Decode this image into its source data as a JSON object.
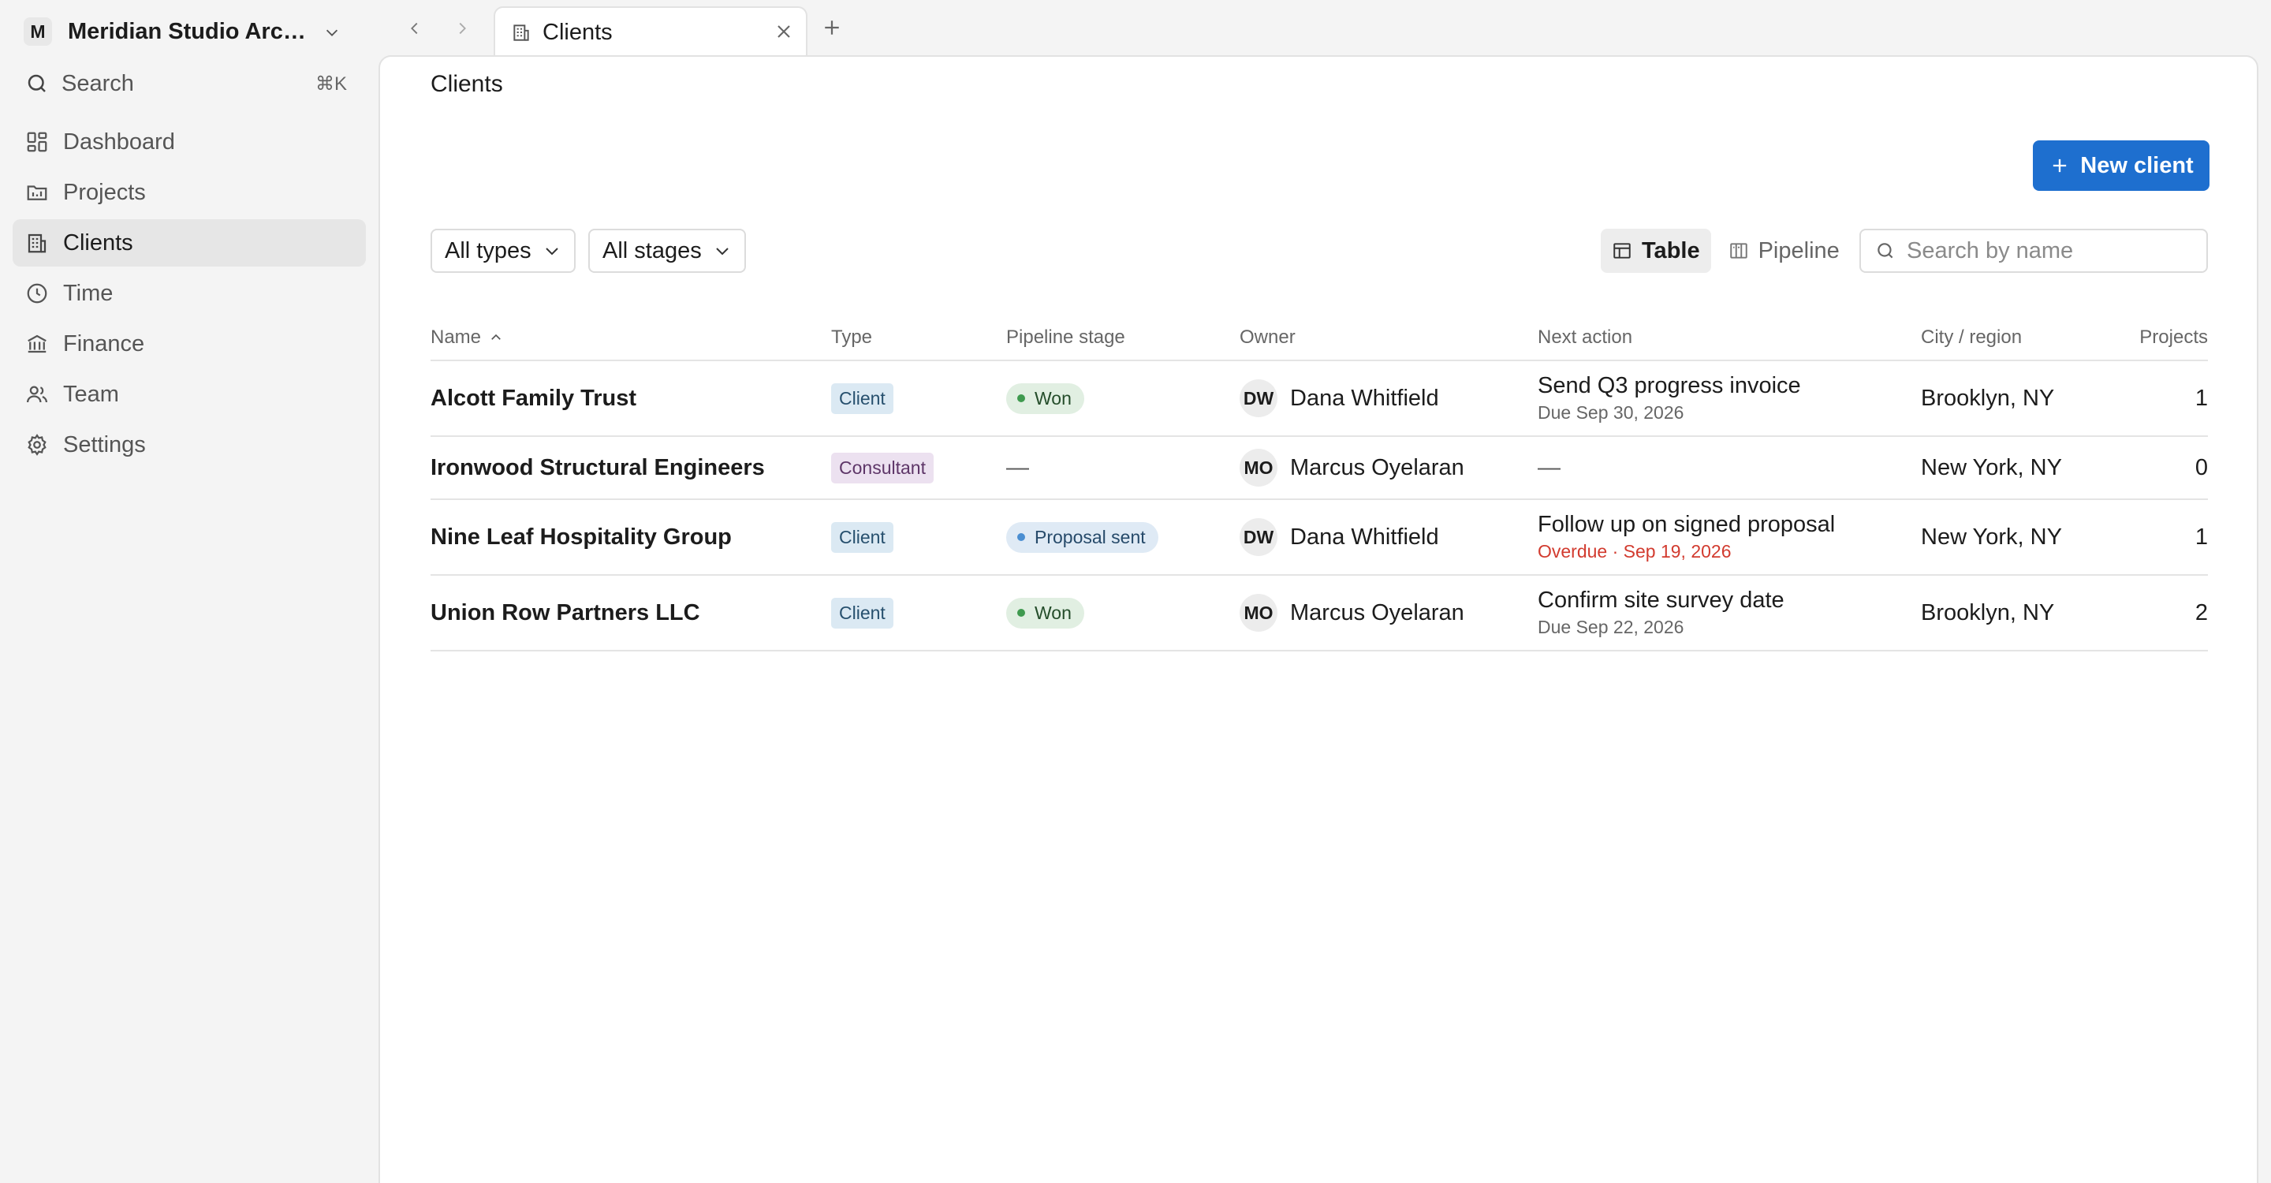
{
  "workspace": {
    "initial": "M",
    "name": "Meridian Studio Architects"
  },
  "search": {
    "label": "Search",
    "shortcut": "⌘K"
  },
  "sidebar": {
    "items": [
      {
        "label": "Dashboard",
        "icon": "dashboard-icon"
      },
      {
        "label": "Projects",
        "icon": "folder-icon"
      },
      {
        "label": "Clients",
        "icon": "building-icon",
        "active": true
      },
      {
        "label": "Time",
        "icon": "clock-icon"
      },
      {
        "label": "Finance",
        "icon": "bank-icon"
      },
      {
        "label": "Team",
        "icon": "users-icon"
      },
      {
        "label": "Settings",
        "icon": "gear-icon"
      }
    ]
  },
  "tabs": [
    {
      "label": "Clients",
      "icon": "building-icon"
    }
  ],
  "page": {
    "title": "Clients"
  },
  "toolbar": {
    "new_button": "New client",
    "type_filter": "All types",
    "stage_filter": "All stages",
    "view_table": "Table",
    "view_pipeline": "Pipeline",
    "search_placeholder": "Search by name"
  },
  "table": {
    "columns": [
      "Name",
      "Type",
      "Pipeline stage",
      "Owner",
      "Next action",
      "City / region",
      "Projects"
    ],
    "sort": {
      "column": "Name",
      "direction": "ascending"
    },
    "rows": [
      {
        "name": "Alcott Family Trust",
        "type": "Client",
        "stage": "Won",
        "owner_initials": "DW",
        "owner": "Dana Whitfield",
        "next_action": "Send Q3 progress invoice",
        "next_due": "Due Sep 30, 2026",
        "city": "Brooklyn, NY",
        "projects": "1"
      },
      {
        "name": "Ironwood Structural Engineers",
        "type": "Consultant",
        "stage": "—",
        "owner_initials": "MO",
        "owner": "Marcus Oyelaran",
        "next_action": "—",
        "next_due": "",
        "city": "New York, NY",
        "projects": "0"
      },
      {
        "name": "Nine Leaf Hospitality Group",
        "type": "Client",
        "stage": "Proposal sent",
        "owner_initials": "DW",
        "owner": "Dana Whitfield",
        "next_action": "Follow up on signed proposal",
        "next_due": "Overdue · Sep 19, 2026",
        "city": "New York, NY",
        "projects": "1"
      },
      {
        "name": "Union Row Partners LLC",
        "type": "Client",
        "stage": "Won",
        "owner_initials": "MO",
        "owner": "Marcus Oyelaran",
        "next_action": "Confirm site survey date",
        "next_due": "Due Sep 22, 2026",
        "city": "Brooklyn, NY",
        "projects": "2"
      }
    ]
  },
  "colors": {
    "accent": "#1e6fcf",
    "won": "#3f9a4f",
    "proposal": "#4a8ed1",
    "overdue": "#d23b2f"
  }
}
